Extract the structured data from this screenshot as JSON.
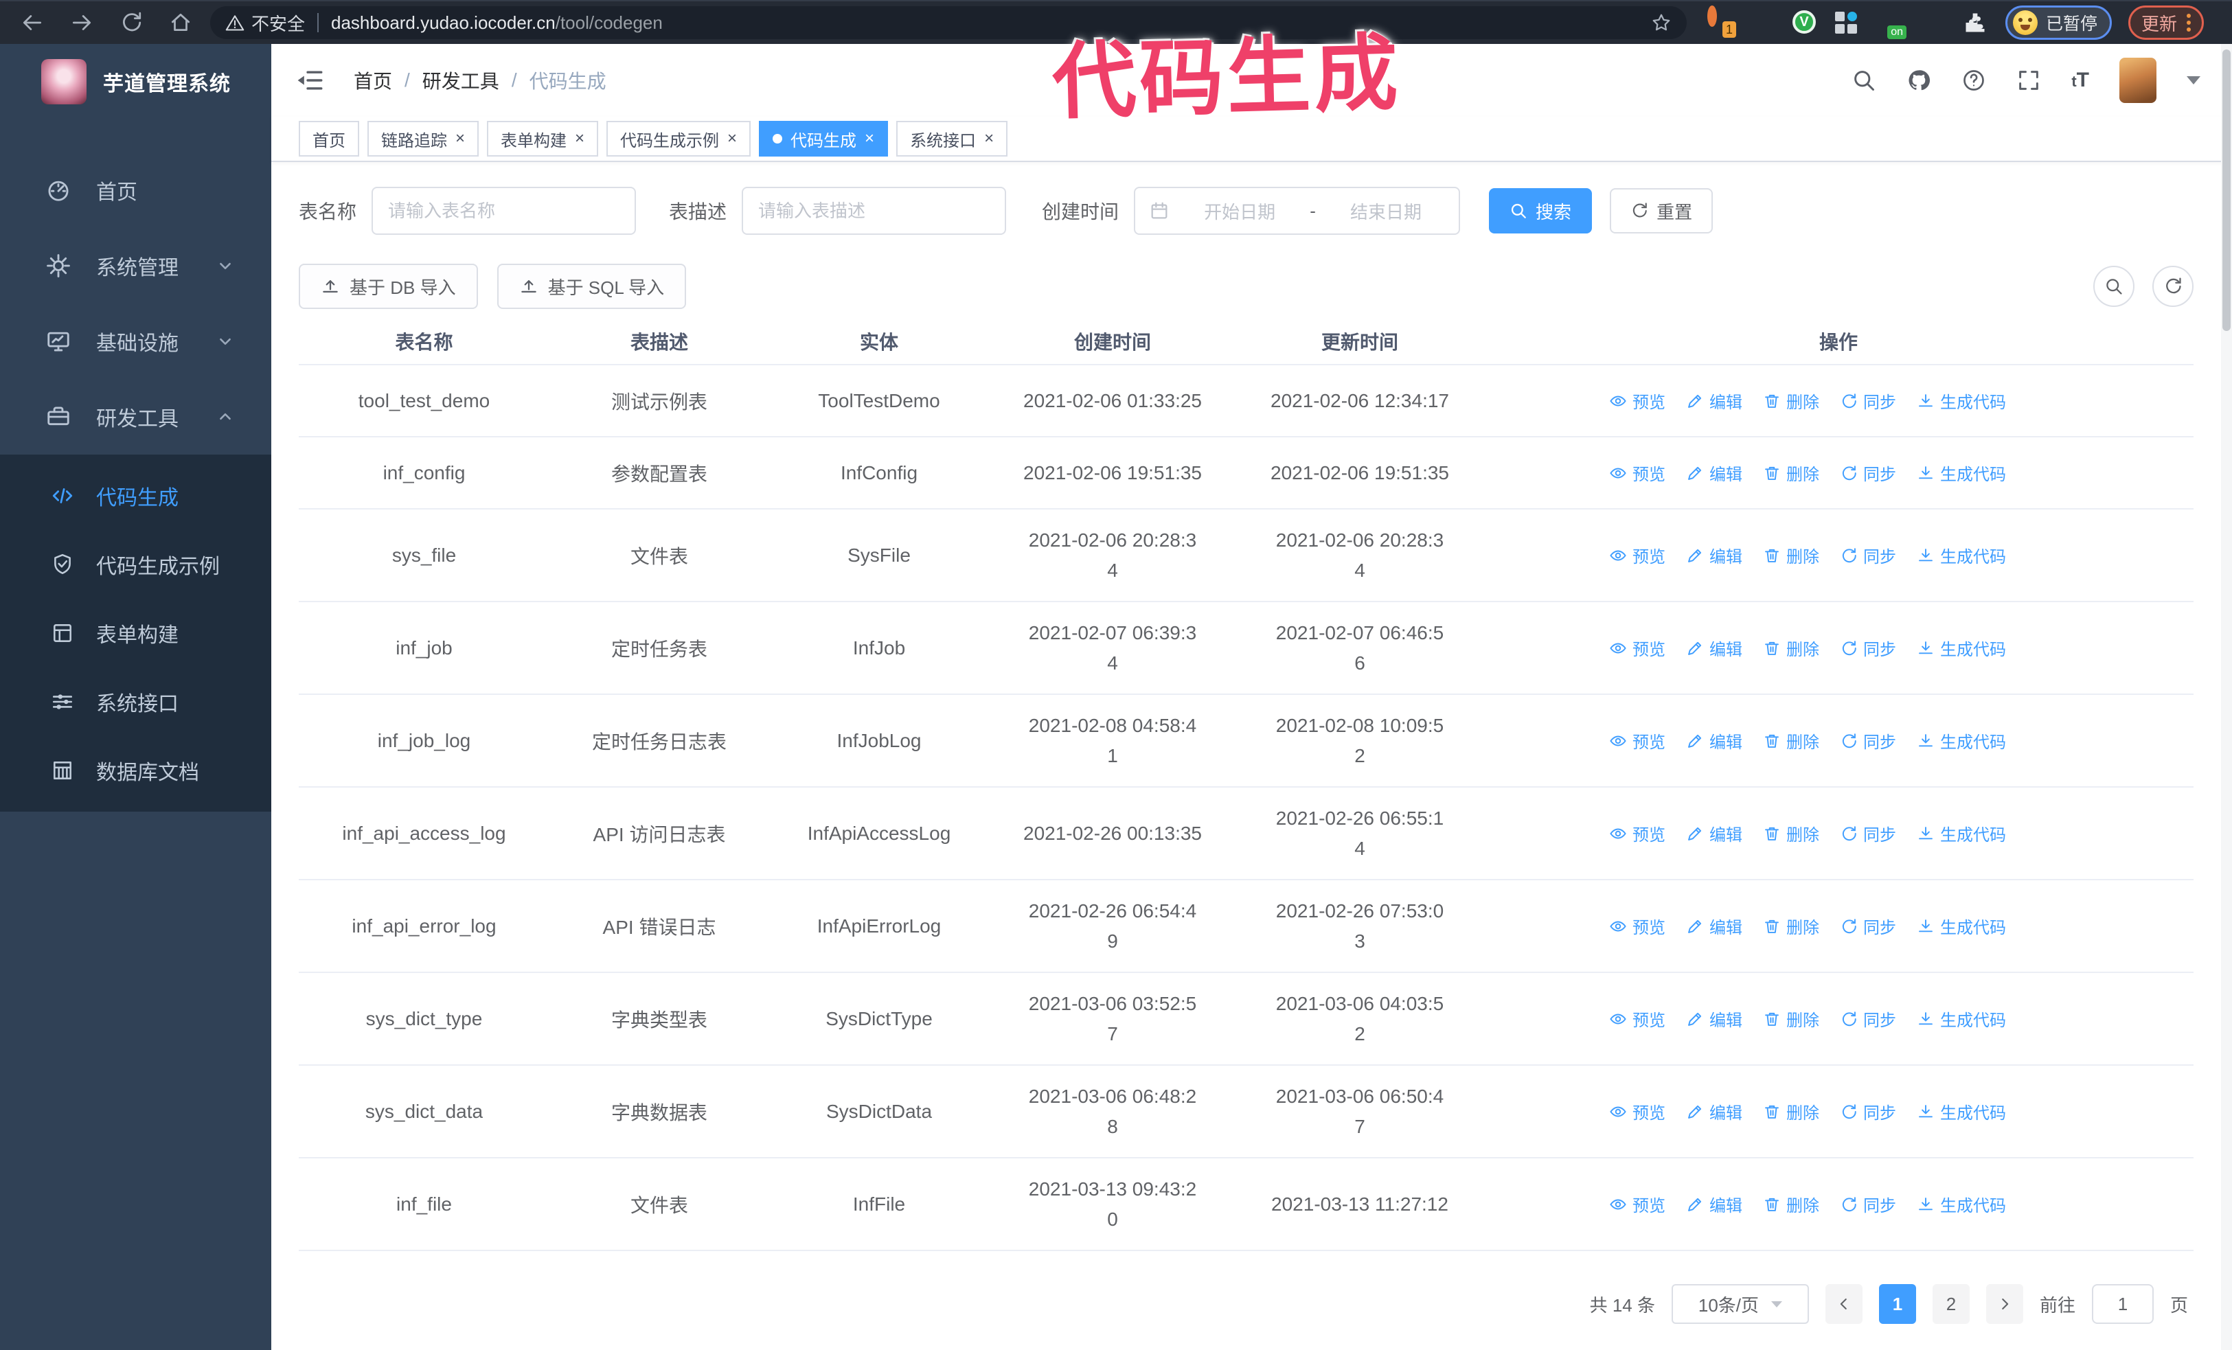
{
  "browser": {
    "security_warning": "不安全",
    "url_host": "dashboard.yudao.iocoder.cn",
    "url_path": "/tool/codegen",
    "profile_badge": "已暂停",
    "update_button": "更新"
  },
  "annotation": {
    "text": "代码生成",
    "color": "#ef4069"
  },
  "sidebar": {
    "title": "芋道管理系统",
    "items": [
      {
        "label": "首页",
        "icon": "dashboard-icon",
        "expandable": false
      },
      {
        "label": "系统管理",
        "icon": "gear-icon",
        "expandable": true,
        "expanded": false
      },
      {
        "label": "基础设施",
        "icon": "infrastructure-icon",
        "expandable": true,
        "expanded": false
      },
      {
        "label": "研发工具",
        "icon": "dev-tools-icon",
        "expandable": true,
        "expanded": true
      }
    ],
    "submenu": [
      {
        "label": "代码生成",
        "icon": "code-icon",
        "active": true
      },
      {
        "label": "代码生成示例",
        "icon": "shield-check-icon",
        "active": false
      },
      {
        "label": "表单构建",
        "icon": "form-icon",
        "active": false
      },
      {
        "label": "系统接口",
        "icon": "sliders-icon",
        "active": false
      },
      {
        "label": "数据库文档",
        "icon": "database-doc-icon",
        "active": false
      }
    ]
  },
  "header": {
    "breadcrumb": {
      "home": "首页",
      "section": "研发工具",
      "current": "代码生成"
    }
  },
  "tabs": [
    {
      "label": "首页",
      "closable": false,
      "active": false
    },
    {
      "label": "链路追踪",
      "closable": true,
      "active": false
    },
    {
      "label": "表单构建",
      "closable": true,
      "active": false
    },
    {
      "label": "代码生成示例",
      "closable": true,
      "active": false
    },
    {
      "label": "代码生成",
      "closable": true,
      "active": true
    },
    {
      "label": "系统接口",
      "closable": true,
      "active": false
    }
  ],
  "filters": {
    "table_name_label": "表名称",
    "table_name_placeholder": "请输入表名称",
    "table_desc_label": "表描述",
    "table_desc_placeholder": "请输入表描述",
    "create_time_label": "创建时间",
    "date_start_placeholder": "开始日期",
    "date_separator": "-",
    "date_end_placeholder": "结束日期",
    "search_label": "搜索",
    "reset_label": "重置"
  },
  "toolbar": {
    "import_db_label": "基于 DB 导入",
    "import_sql_label": "基于 SQL 导入"
  },
  "table": {
    "columns": [
      "表名称",
      "表描述",
      "实体",
      "创建时间",
      "更新时间",
      "操作"
    ],
    "actions": [
      {
        "label": "预览",
        "icon": "eye-icon"
      },
      {
        "label": "编辑",
        "icon": "pencil-icon"
      },
      {
        "label": "删除",
        "icon": "trash-icon"
      },
      {
        "label": "同步",
        "icon": "sync-icon"
      },
      {
        "label": "生成代码",
        "icon": "download-icon"
      }
    ],
    "rows": [
      {
        "name": "tool_test_demo",
        "desc": "测试示例表",
        "entity": "ToolTestDemo",
        "created": "2021-02-06 01:33:25",
        "updated": "2021-02-06 12:34:17"
      },
      {
        "name": "inf_config",
        "desc": "参数配置表",
        "entity": "InfConfig",
        "created": "2021-02-06 19:51:35",
        "updated": "2021-02-06 19:51:35"
      },
      {
        "name": "sys_file",
        "desc": "文件表",
        "entity": "SysFile",
        "created": "2021-02-06 20:28:3\n4",
        "updated": "2021-02-06 20:28:3\n4"
      },
      {
        "name": "inf_job",
        "desc": "定时任务表",
        "entity": "InfJob",
        "created": "2021-02-07 06:39:3\n4",
        "updated": "2021-02-07 06:46:5\n6"
      },
      {
        "name": "inf_job_log",
        "desc": "定时任务日志表",
        "entity": "InfJobLog",
        "created": "2021-02-08 04:58:4\n1",
        "updated": "2021-02-08 10:09:5\n2"
      },
      {
        "name": "inf_api_access_log",
        "desc": "API 访问日志表",
        "entity": "InfApiAccessLog",
        "created": "2021-02-26 00:13:35",
        "updated": "2021-02-26 06:55:1\n4"
      },
      {
        "name": "inf_api_error_log",
        "desc": "API 错误日志",
        "entity": "InfApiErrorLog",
        "created": "2021-02-26 06:54:4\n9",
        "updated": "2021-02-26 07:53:0\n3"
      },
      {
        "name": "sys_dict_type",
        "desc": "字典类型表",
        "entity": "SysDictType",
        "created": "2021-03-06 03:52:5\n7",
        "updated": "2021-03-06 04:03:5\n2"
      },
      {
        "name": "sys_dict_data",
        "desc": "字典数据表",
        "entity": "SysDictData",
        "created": "2021-03-06 06:48:2\n8",
        "updated": "2021-03-06 06:50:4\n7"
      },
      {
        "name": "inf_file",
        "desc": "文件表",
        "entity": "InfFile",
        "created": "2021-03-13 09:43:2\n0",
        "updated": "2021-03-13 11:27:12"
      }
    ]
  },
  "pagination": {
    "total_text": "共 14 条",
    "page_size": "10条/页",
    "pages": [
      "1",
      "2"
    ],
    "active_page": "1",
    "goto_label": "前往",
    "goto_value": "1",
    "goto_suffix": "页"
  },
  "colors": {
    "accent": "#409eff",
    "sidebar_bg": "#304156",
    "submenu_bg": "#1f2d3d",
    "annotation": "#ef4069",
    "browser_bar_bg": "#252b35"
  }
}
